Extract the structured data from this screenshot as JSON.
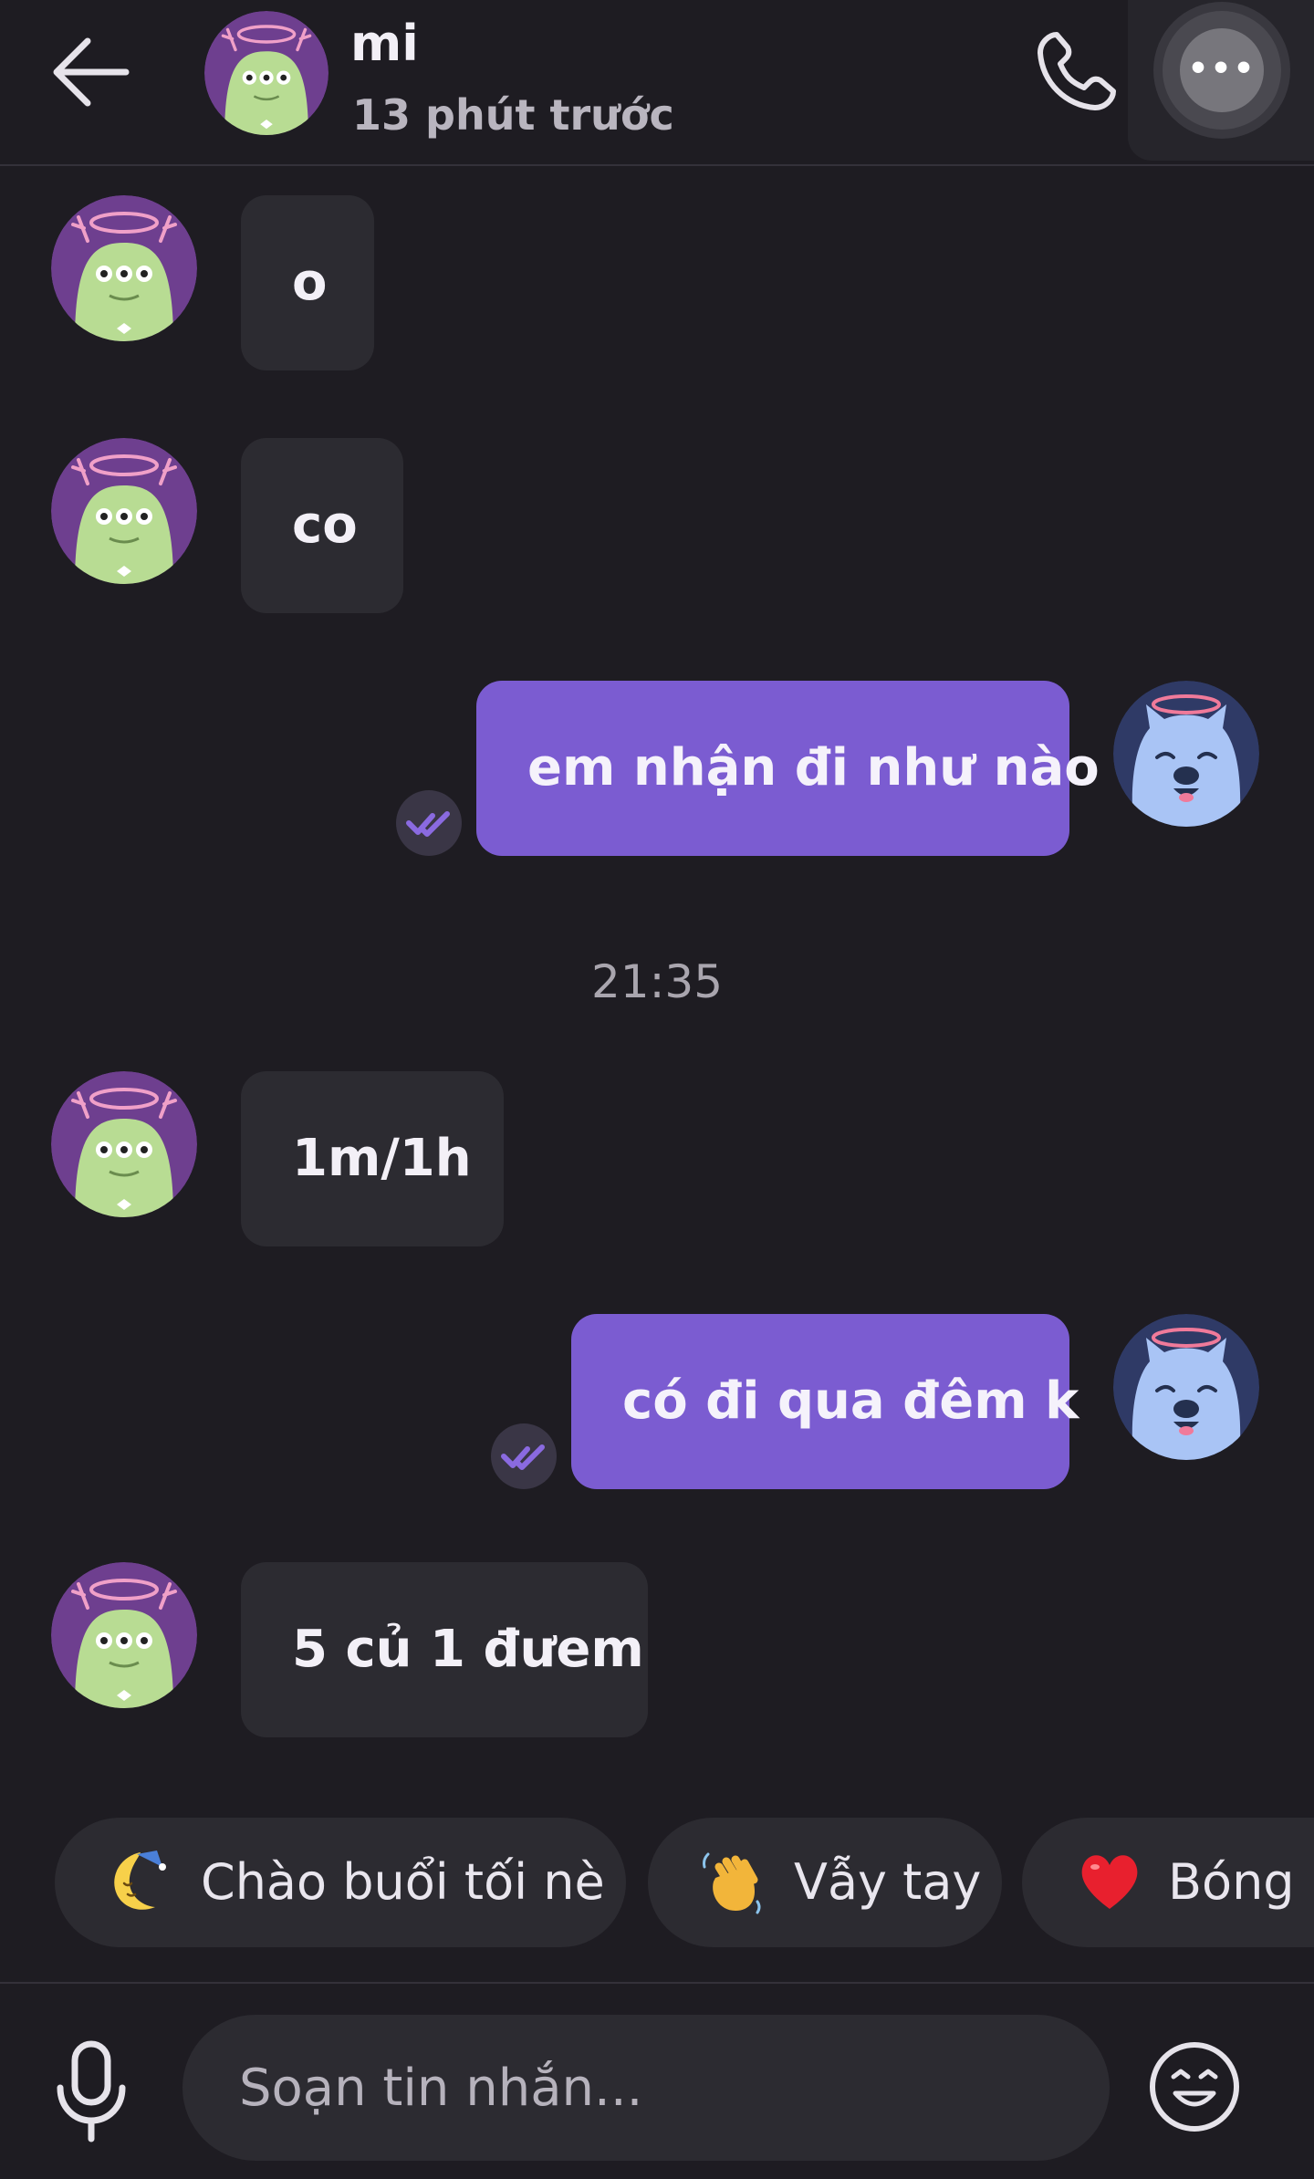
{
  "header": {
    "contact_name": "mi",
    "last_seen": "13 phút trước"
  },
  "messages": [
    {
      "direction": "in",
      "text": "o"
    },
    {
      "direction": "in",
      "text": "co"
    },
    {
      "direction": "out",
      "text": "em nhận đi như nào",
      "status": "read"
    },
    {
      "direction": "in",
      "text": "1m/1h"
    },
    {
      "direction": "out",
      "text": "có đi qua đêm k",
      "status": "read"
    },
    {
      "direction": "in",
      "text": "5 củ 1 đưem"
    }
  ],
  "time_divider": "21:35",
  "quick_replies": [
    {
      "icon": "sleepy-moon-icon",
      "label": "Chào buổi tối nè"
    },
    {
      "icon": "waving-hand-icon",
      "label": "Vẫy tay"
    },
    {
      "icon": "heart-icon",
      "label": "Bóng b"
    }
  ],
  "composer": {
    "placeholder": "Soạn tin nhắn..."
  },
  "colors": {
    "background": "#1e1c22",
    "incoming_bubble": "#2c2b31",
    "outgoing_bubble": "#7b5cd1",
    "accent": "#8a6ae0"
  }
}
